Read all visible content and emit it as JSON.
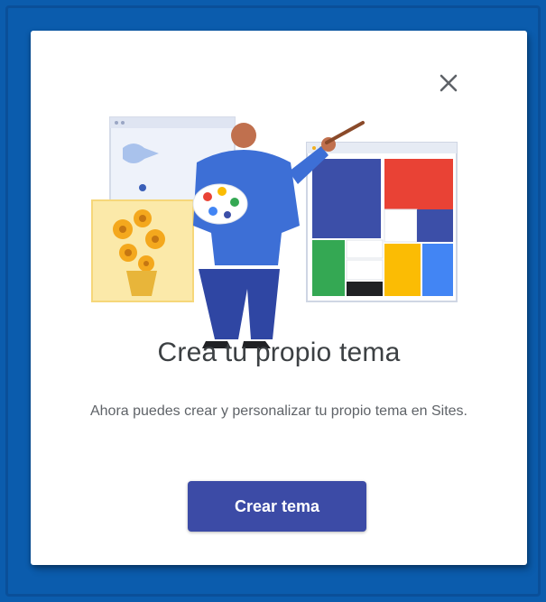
{
  "dialog": {
    "title": "Crea tu propio tema",
    "description": "Ahora puedes crear y personalizar tu propio tema en Sites.",
    "cta_label": "Crear tema",
    "close_icon": "close-icon",
    "illustration_icon": "artist-painting-illustration"
  },
  "colors": {
    "frame": "#0b5cad",
    "button": "#3c4ba6",
    "title_text": "#3c4043",
    "body_text": "#5f6368"
  }
}
